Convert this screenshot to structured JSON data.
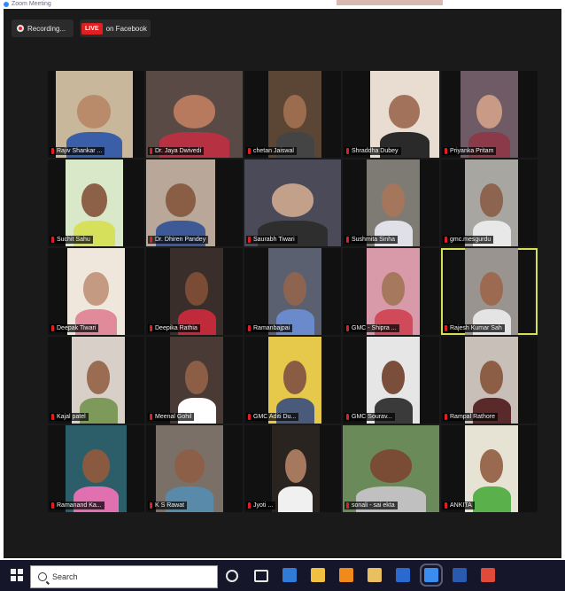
{
  "window": {
    "title": "Zoom Meeting"
  },
  "meeting_toolbar": {
    "recording_label": "Recording...",
    "live_badge": "LIVE",
    "live_platform": "on Facebook"
  },
  "participants": [
    {
      "name": "Rajiv Shankar ...",
      "bg": "#c9b79b",
      "skin": "#b98b6a",
      "shirt": "#3a5fa8"
    },
    {
      "name": "Dr. Jaya Dwivedi",
      "bg": "#5a4a46",
      "skin": "#b77a5e",
      "shirt": "#b63242"
    },
    {
      "name": "chetan Jaiswal",
      "bg": "#5b4636",
      "skin": "#9c6c4e",
      "shirt": "#444444"
    },
    {
      "name": "Shraddha Dubey",
      "bg": "#e8ddd0",
      "skin": "#a3725a",
      "shirt": "#2a2a2a"
    },
    {
      "name": "Priyanka Pritam",
      "bg": "#6e5b66",
      "skin": "#c99a86",
      "shirt": "#8a3a48"
    },
    {
      "name": "Suchit Sahu",
      "bg": "#d8e8c8",
      "skin": "#8d6048",
      "shirt": "#d6e05a"
    },
    {
      "name": "Dr. Dhiren Pandey",
      "bg": "#b9a89a",
      "skin": "#8a5d45",
      "shirt": "#3d5a96"
    },
    {
      "name": "Saurabh Tiwari",
      "bg": "#4a4a58",
      "skin": "#c2a08a",
      "shirt": "#2e2e2e"
    },
    {
      "name": "Sushmita Sinha",
      "bg": "#7e7a74",
      "skin": "#a4765c",
      "shirt": "#e0e0e8"
    },
    {
      "name": "gmc.mesgurdu",
      "bg": "#a8a6a0",
      "skin": "#8c6450",
      "shirt": "#e8e8e8"
    },
    {
      "name": "Deepak Tiwari",
      "bg": "#efe6dc",
      "skin": "#c49a82",
      "shirt": "#e08a9a"
    },
    {
      "name": "Deepika Rathia",
      "bg": "#3a2e2a",
      "skin": "#7a4c36",
      "shirt": "#c02a3a"
    },
    {
      "name": "Ramanbajpai",
      "bg": "#5a6070",
      "skin": "#8c6450",
      "shirt": "#6a8acb"
    },
    {
      "name": "GMC - Shipra ...",
      "bg": "#d89aa8",
      "skin": "#a6785e",
      "shirt": "#d04a5a"
    },
    {
      "name": "Rajesh Kumar Sah",
      "bg": "#9a9490",
      "skin": "#9c6a50",
      "shirt": "#e4e4e4"
    },
    {
      "name": "Kajal patel",
      "bg": "#d8d0c8",
      "skin": "#9a6c52",
      "shirt": "#7e9a5a"
    },
    {
      "name": "Meenal Gohil",
      "bg": "#4a3a36",
      "skin": "#8c5e46",
      "shirt": "#ffffff"
    },
    {
      "name": "GMC Aditi Du...",
      "bg": "#e6c84a",
      "skin": "#8a5c44",
      "shirt": "#4a5a7a"
    },
    {
      "name": "GMC Sourav...",
      "bg": "#e6e6e6",
      "skin": "#7a4e3a",
      "shirt": "#3a3a3a"
    },
    {
      "name": "Rampal Rathore",
      "bg": "#c8c0b8",
      "skin": "#8c5e46",
      "shirt": "#5a2a2a"
    },
    {
      "name": "Ramanand Ka...",
      "bg": "#2c5e6a",
      "skin": "#8a5a40",
      "shirt": "#e070b0"
    },
    {
      "name": "K S Rawat",
      "bg": "#7a7068",
      "skin": "#8c6048",
      "shirt": "#5a8aaa"
    },
    {
      "name": "Jyoti ...",
      "bg": "#2a2420",
      "skin": "#a6785e",
      "shirt": "#f0f0f0"
    },
    {
      "name": "sonali - sai ekta",
      "bg": "#6a8a5a",
      "skin": "#7a4c36",
      "shirt": "#c0c0c0"
    },
    {
      "name": "ANKITA",
      "bg": "#e6e2d4",
      "skin": "#9a6a50",
      "shirt": "#5ab04a"
    }
  ],
  "active_speaker_index": 14,
  "taskbar": {
    "search_placeholder": "Search",
    "icons": [
      "task-view-icon",
      "cortana-icon",
      "edge-icon",
      "file-explorer-icon",
      "vlc-icon",
      "files-icon",
      "chrome-dark-icon",
      "zoom-icon",
      "word-icon",
      "chrome-icon"
    ]
  }
}
